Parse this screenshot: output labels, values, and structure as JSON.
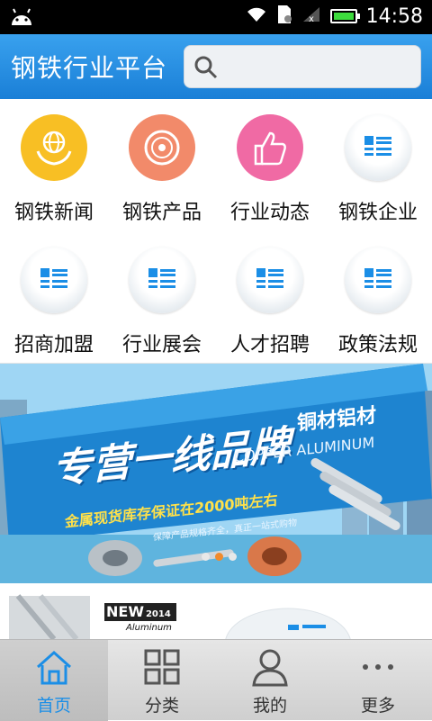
{
  "status_bar": {
    "time": "14:58"
  },
  "header": {
    "title": "钢铁行业平台",
    "search_placeholder": ""
  },
  "grid": [
    {
      "label": "钢铁新闻",
      "icon": "globe-hands-icon",
      "color": "#f8bf24"
    },
    {
      "label": "钢铁产品",
      "icon": "disc-icon",
      "color": "#f28a6a"
    },
    {
      "label": "行业动态",
      "icon": "thumbs-up-icon",
      "color": "#f06aa4"
    },
    {
      "label": "钢铁企业",
      "icon": "list-icon",
      "color": ""
    },
    {
      "label": "招商加盟",
      "icon": "list-icon",
      "color": ""
    },
    {
      "label": "行业展会",
      "icon": "list-icon",
      "color": ""
    },
    {
      "label": "人才招聘",
      "icon": "list-icon",
      "color": ""
    },
    {
      "label": "政策法规",
      "icon": "list-icon",
      "color": ""
    }
  ],
  "banner": {
    "headline": "专营一线品牌",
    "tag": "铜材铝材",
    "english": "COPPER ALUMINUM",
    "subline": "金属现货库存保证在2000吨左右",
    "small_text": "保障产品规格齐全，真正一站式购物",
    "active_dot": 1,
    "dot_count": 3
  },
  "promo": {
    "badge": "NEW",
    "year": "2014",
    "word": "Aluminum"
  },
  "tabbar": [
    {
      "label": "首页",
      "icon": "home-icon",
      "active": true
    },
    {
      "label": "分类",
      "icon": "grid-icon",
      "active": false
    },
    {
      "label": "我的",
      "icon": "user-icon",
      "active": false
    },
    {
      "label": "更多",
      "icon": "more-icon",
      "active": false
    }
  ],
  "colors": {
    "accent": "#1b8ee6",
    "header": "#2a8fe0"
  }
}
